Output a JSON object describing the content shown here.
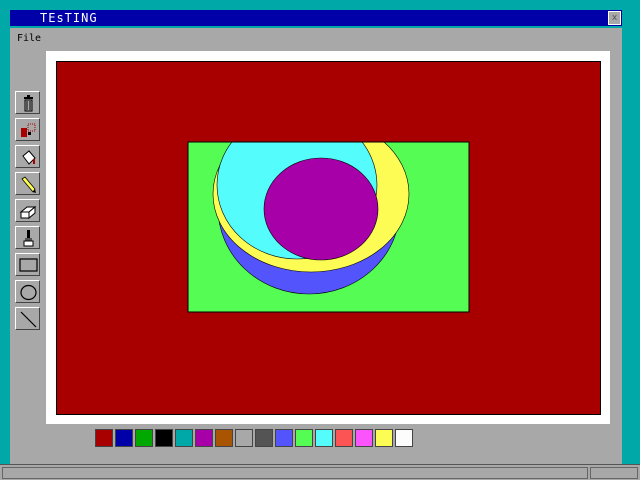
{
  "window": {
    "title": "TEsTING",
    "close_label": "x"
  },
  "menu": {
    "file_label": "File"
  },
  "tools": [
    {
      "name": "trash-icon",
      "selected": false
    },
    {
      "name": "select-icon",
      "selected": false
    },
    {
      "name": "fill-icon",
      "selected": false
    },
    {
      "name": "pencil-icon",
      "selected": false
    },
    {
      "name": "eraser-icon",
      "selected": false
    },
    {
      "name": "brush-icon",
      "selected": false
    },
    {
      "name": "rectangle-icon",
      "selected": false
    },
    {
      "name": "ellipse-icon",
      "selected": false
    },
    {
      "name": "line-icon",
      "selected": false
    }
  ],
  "palette": {
    "colors": [
      "#a80000",
      "#0000a8",
      "#00a800",
      "#000000",
      "#00a8a8",
      "#a800a8",
      "#a85400",
      "#a8a8a8",
      "#545454",
      "#5454fc",
      "#54fc54",
      "#54fcfc",
      "#fc5454",
      "#fc54fc",
      "#fcfc54",
      "#fcfcfc"
    ]
  },
  "canvas": {
    "background": "#a80000",
    "rect_color": "#54fc54",
    "blue_shape": "#5454fc",
    "yellow_shape": "#fcfc54",
    "cyan_shape": "#54fcfc",
    "magenta_shape": "#a800a8"
  }
}
